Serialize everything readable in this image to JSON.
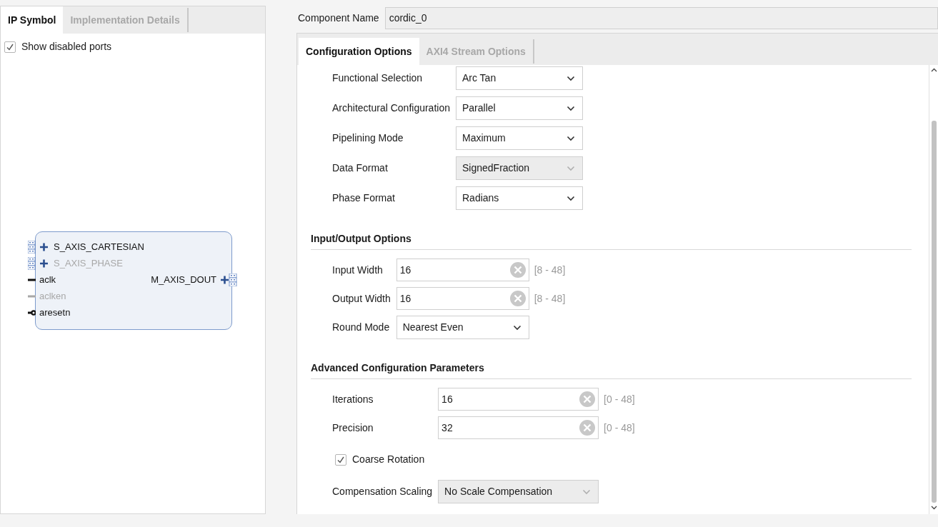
{
  "left_panel": {
    "tabs": [
      {
        "label": "IP Symbol",
        "selected": true
      },
      {
        "label": "Implementation Details",
        "selected": false
      }
    ],
    "show_disabled_ports": {
      "label": "Show disabled ports",
      "checked": true
    },
    "symbol": {
      "left_ports": [
        {
          "name": "S_AXIS_CARTESIAN",
          "kind": "bus",
          "disabled": false
        },
        {
          "name": "S_AXIS_PHASE",
          "kind": "bus",
          "disabled": true
        },
        {
          "name": "aclk",
          "kind": "clock",
          "disabled": false
        },
        {
          "name": "aclken",
          "kind": "clock",
          "disabled": true
        },
        {
          "name": "aresetn",
          "kind": "reset",
          "disabled": false
        }
      ],
      "right_ports": [
        {
          "name": "M_AXIS_DOUT",
          "kind": "bus",
          "disabled": false
        }
      ]
    }
  },
  "component_name": {
    "label": "Component Name",
    "value": "cordic_0"
  },
  "config_tabs": [
    {
      "label": "Configuration Options",
      "selected": true
    },
    {
      "label": "AXI4 Stream Options",
      "selected": false
    }
  ],
  "sections": [
    {
      "rows": [
        {
          "kind": "dropdown",
          "label": "Functional Selection",
          "value": "Arc Tan",
          "disabled": false
        },
        {
          "kind": "dropdown",
          "label": "Architectural Configuration",
          "value": "Parallel",
          "disabled": false
        },
        {
          "kind": "dropdown",
          "label": "Pipelining Mode",
          "value": "Maximum",
          "disabled": false
        },
        {
          "kind": "dropdown",
          "label": "Data Format",
          "value": "SignedFraction",
          "disabled": true
        },
        {
          "kind": "dropdown",
          "label": "Phase Format",
          "value": "Radians",
          "disabled": false
        }
      ]
    },
    {
      "title": "Input/Output Options",
      "rows": [
        {
          "kind": "number",
          "label": "Input Width",
          "value": "16",
          "range": "[8 - 48]"
        },
        {
          "kind": "number",
          "label": "Output Width",
          "value": "16",
          "range": "[8 - 48]"
        },
        {
          "kind": "dropdown",
          "label": "Round Mode",
          "value": "Nearest Even",
          "disabled": false
        }
      ]
    },
    {
      "title": "Advanced Configuration Parameters",
      "rows": [
        {
          "kind": "number",
          "label": "Iterations",
          "value": "16",
          "range": "[0 - 48]"
        },
        {
          "kind": "number",
          "label": "Precision",
          "value": "32",
          "range": "[0 - 48]"
        },
        {
          "kind": "checkbox",
          "label": "Coarse Rotation",
          "checked": true
        },
        {
          "kind": "dropdown",
          "label": "Compensation Scaling",
          "value": "No Scale Compensation",
          "disabled": true
        }
      ]
    }
  ]
}
